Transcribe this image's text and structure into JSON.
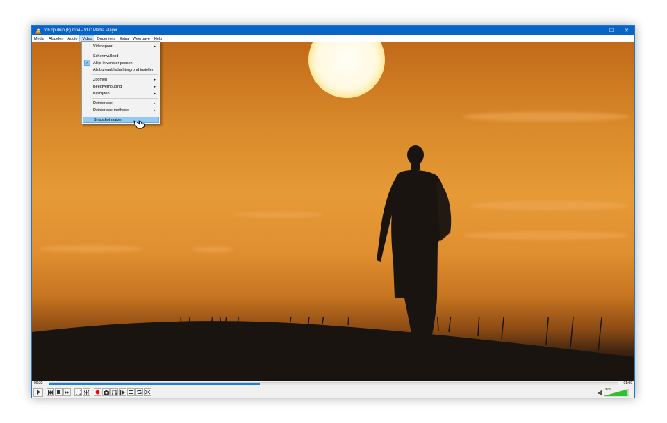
{
  "window": {
    "title": "rob op duin (8).mp4 - VLC Media Player",
    "buttons": {
      "minimize": "—",
      "maximize": "☐",
      "close": "✕"
    }
  },
  "menubar": {
    "items": [
      "Media",
      "Afspelen",
      "Audio",
      "Video",
      "Ondertitels",
      "Extra",
      "Weergave",
      "Help"
    ],
    "active": "Video"
  },
  "video_menu": {
    "items": [
      {
        "label": "Videospoor",
        "submenu": true
      },
      {
        "label": "Schermvullend"
      },
      {
        "label": "Altijd in venster passen",
        "checked": true
      },
      {
        "label": "Als bureaubladachtergrond instellen"
      },
      {
        "label": "Zoomen",
        "submenu": true
      },
      {
        "label": "Beeldverhouding",
        "submenu": true
      },
      {
        "label": "Bijsnijden",
        "submenu": true
      },
      {
        "label": "Deinterlace",
        "submenu": true
      },
      {
        "label": "Deinterlace-methode",
        "submenu": true
      },
      {
        "label": "Snapshot maken",
        "highlighted": true
      }
    ],
    "submenu_arrow": "▸",
    "check_mark": "✓"
  },
  "player": {
    "elapsed": "00:22",
    "total": "01:00",
    "progress": 0.37,
    "volume_percent": "95%",
    "volume": 0.95,
    "button_icons": [
      "play-icon",
      "prev-icon",
      "stop-icon",
      "next-icon",
      "fullscreen-icon",
      "extended-settings-icon",
      "playlist-icon",
      "record-icon",
      "snapshot-icon",
      "loop-ab-icon",
      "frame-by-frame-icon",
      "playlist-toggle-icon",
      "loop-icon",
      "shuffle-icon",
      "speaker-icon"
    ]
  },
  "colors": {
    "titlebar": "#0a64c8",
    "seek_fill": "#1e7fd8",
    "menu_highlight": "#91c9f7",
    "record": "#e01010",
    "volume": "#2fbf2f"
  }
}
